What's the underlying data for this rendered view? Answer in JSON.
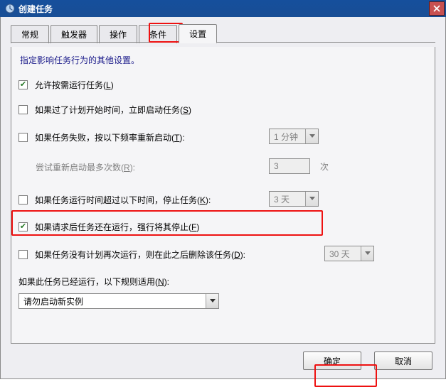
{
  "window": {
    "title": "创建任务"
  },
  "tabs": {
    "general": "常规",
    "triggers": "触发器",
    "actions": "操作",
    "conditions": "条件",
    "settings": "设置"
  },
  "desc": "指定影响任务行为的其他设置。",
  "opts": {
    "allow_run_on_demand": "允许按需运行任务",
    "allow_run_on_demand_key": "L",
    "start_if_missed": "如果过了计划开始时间，立即启动任务",
    "start_if_missed_key": "S",
    "restart_on_fail": "如果任务失败，按以下频率重新启动",
    "restart_on_fail_key": "T",
    "restart_interval": "1 分钟",
    "retry_label": "尝试重新启动最多次数",
    "retry_key": "R",
    "retry_value": "3",
    "retry_suffix": "次",
    "stop_if_long": "如果任务运行时间超过以下时间，停止任务",
    "stop_if_long_key": "K",
    "stop_if_long_value": "3 天",
    "force_stop": "如果请求后任务还在运行，强行将其停止",
    "force_stop_key": "F",
    "delete_if_not": "如果任务没有计划再次运行，则在此之后删除该任务",
    "delete_if_not_key": "D",
    "delete_after": "30 天",
    "rule_label": "如果此任务已经运行，以下规则适用",
    "rule_key": "N",
    "rule_value": "请勿启动新实例"
  },
  "buttons": {
    "ok": "确定",
    "cancel": "取消"
  },
  "checks": {
    "allow_run_on_demand": true,
    "start_if_missed": false,
    "restart_on_fail": false,
    "stop_if_long": false,
    "force_stop": true,
    "delete_if_not": false
  }
}
